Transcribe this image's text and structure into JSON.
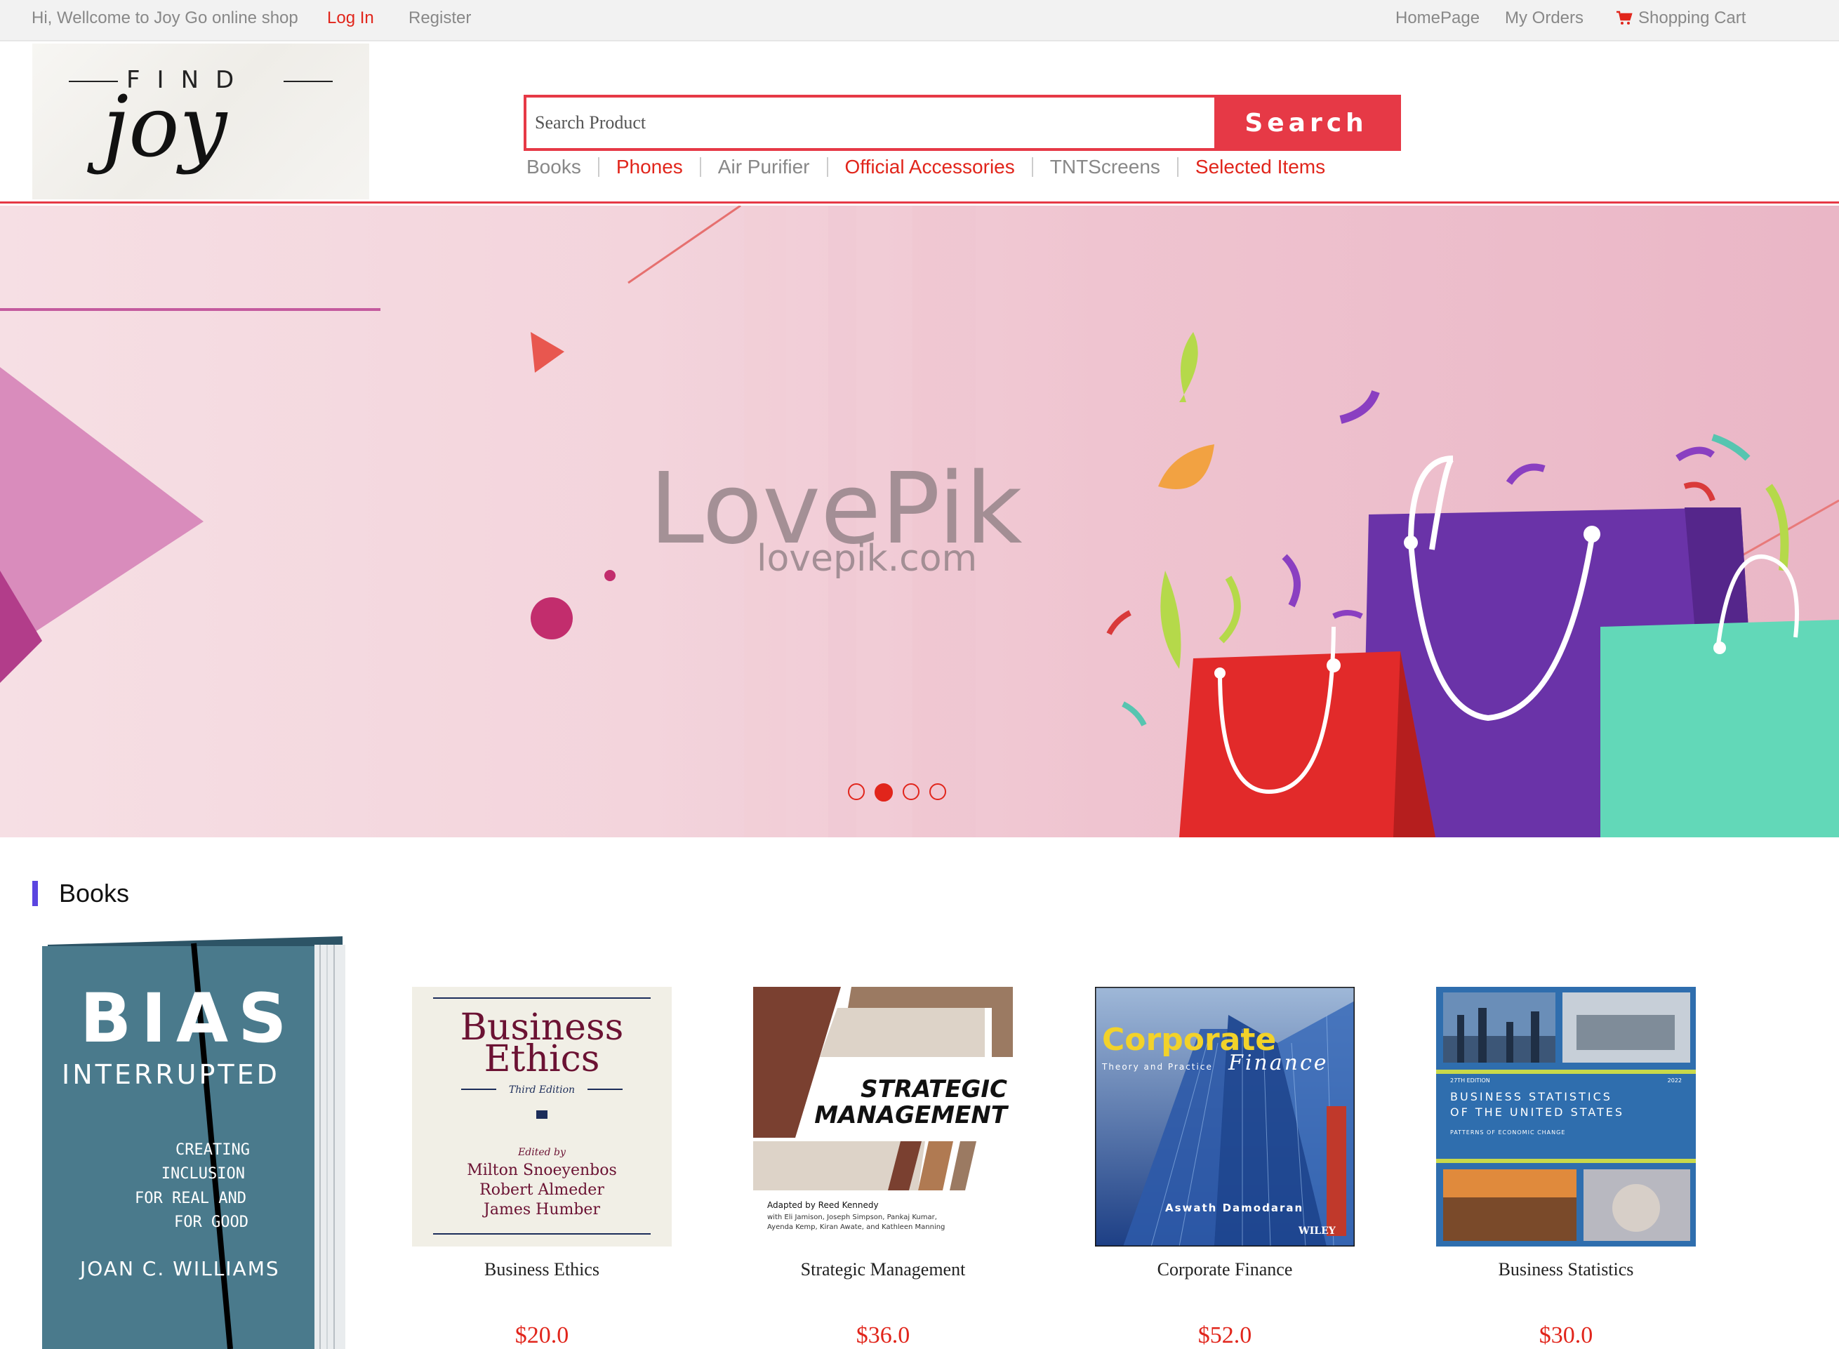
{
  "topbar": {
    "welcome": "Hi, Wellcome to Joy Go online shop",
    "login": "Log In",
    "register": "Register",
    "home": "HomePage",
    "orders": "My Orders",
    "cart": "Shopping Cart"
  },
  "logo": {
    "find": "FIND",
    "joy": "joy"
  },
  "search": {
    "placeholder": "Search Product",
    "button": "Search"
  },
  "categories": [
    {
      "label": "Books"
    },
    {
      "label": "Phones"
    },
    {
      "label": "Air Purifier"
    },
    {
      "label": "Official Accessories"
    },
    {
      "label": "TNTScreens"
    },
    {
      "label": "Selected Items"
    }
  ],
  "banner": {
    "watermark": "LovePik",
    "watermark_sub": "lovepik.com",
    "slide_count": 4,
    "active_slide": 2
  },
  "books_section": {
    "title": "Books",
    "featured": {
      "cover_title": "BIAS",
      "cover_sub": "INTERRUPTED",
      "cover_tag1": "CREATING",
      "cover_tag2": "INCLUSION",
      "cover_tag3": "FOR REAL AND",
      "cover_tag4": "FOR GOOD",
      "cover_author": "JOAN C. WILLIAMS"
    },
    "products": [
      {
        "name": "Business Ethics",
        "price": "$20.0",
        "cover_title1": "Business",
        "cover_title2": "Ethics",
        "cover_edition": "Third Edition",
        "cover_edited": "Edited by",
        "cover_ed1": "Milton Snoeyenbos",
        "cover_ed2": "Robert Almeder",
        "cover_ed3": "James Humber"
      },
      {
        "name": "Strategic Management",
        "price": "$36.0",
        "cover_title1": "STRATEGIC",
        "cover_title2": "MANAGEMENT",
        "cover_adapted": "Adapted by Reed Kennedy",
        "cover_with1": "with Eli Jamison, Joseph Simpson, Pankaj Kumar,",
        "cover_with2": "Ayenda Kemp, Kiran Awate, and Kathleen Manning"
      },
      {
        "name": "Corporate Finance",
        "price": "$52.0",
        "cover_title1": "Corporate",
        "cover_title2": "Finance",
        "cover_sub": "Theory and Practice",
        "cover_author": "Aswath Damodaran",
        "cover_pub": "WILEY"
      },
      {
        "name": "Business Statistics",
        "price": "$30.0",
        "cover_title1": "BUSINESS STATISTICS",
        "cover_title2": "OF THE UNITED STATES",
        "cover_sub": "PATTERNS OF ECONOMIC CHANGE",
        "cover_edition": "27TH EDITION",
        "cover_year": "2022"
      }
    ]
  },
  "colors": {
    "accent": "#e63946",
    "link_red": "#e1251b",
    "section_bar": "#5b45e0"
  }
}
